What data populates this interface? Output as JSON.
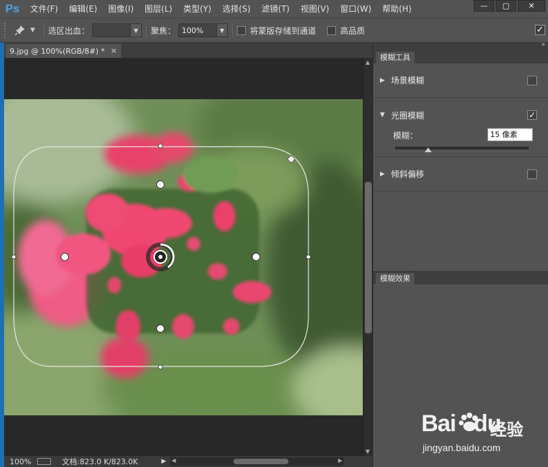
{
  "app": {
    "logo": "Ps"
  },
  "menu": [
    "文件(F)",
    "编辑(E)",
    "图像(I)",
    "图层(L)",
    "类型(Y)",
    "选择(S)",
    "滤镜(T)",
    "视图(V)",
    "窗口(W)",
    "帮助(H)"
  ],
  "window_controls": {
    "minimize": "—",
    "maximize": "▢",
    "close": "✕"
  },
  "options": {
    "tool_icon": "pin-icon",
    "selection_bleed_label": "选区出血：",
    "selection_bleed_value": "",
    "focus_label": "聚焦：",
    "focus_value": "100%",
    "save_mask_label": "将蒙版存储到通道",
    "save_mask_checked": false,
    "high_quality_label": "高品质",
    "high_quality_checked": false,
    "ok_checked": true
  },
  "document": {
    "tab_title": "9.jpg @ 100%(RGB/8#) *",
    "close": "×"
  },
  "status": {
    "zoom": "100%",
    "doc_info": "文档:823.0 K/823.0K",
    "arrow": "▶"
  },
  "panels": {
    "blur_tools": {
      "tab": "模糊工具",
      "field_blur": {
        "label": "场景模糊",
        "checked": false
      },
      "iris_blur": {
        "label": "光圈模糊",
        "checked": true,
        "amount_label": "模糊：",
        "amount_value": "15 像素",
        "amount_fraction": 0.24
      },
      "tilt_shift": {
        "label": "倾斜偏移",
        "checked": false
      }
    },
    "blur_effects": {
      "tab": "模糊效果"
    }
  },
  "watermark": {
    "brand": "Bai",
    "brand2": "du",
    "cn": "经验",
    "url": "jingyan.baidu.com"
  },
  "colors": {
    "accent": "#4ba3e8",
    "panel": "#535353",
    "canvas_bg": "#282828"
  }
}
